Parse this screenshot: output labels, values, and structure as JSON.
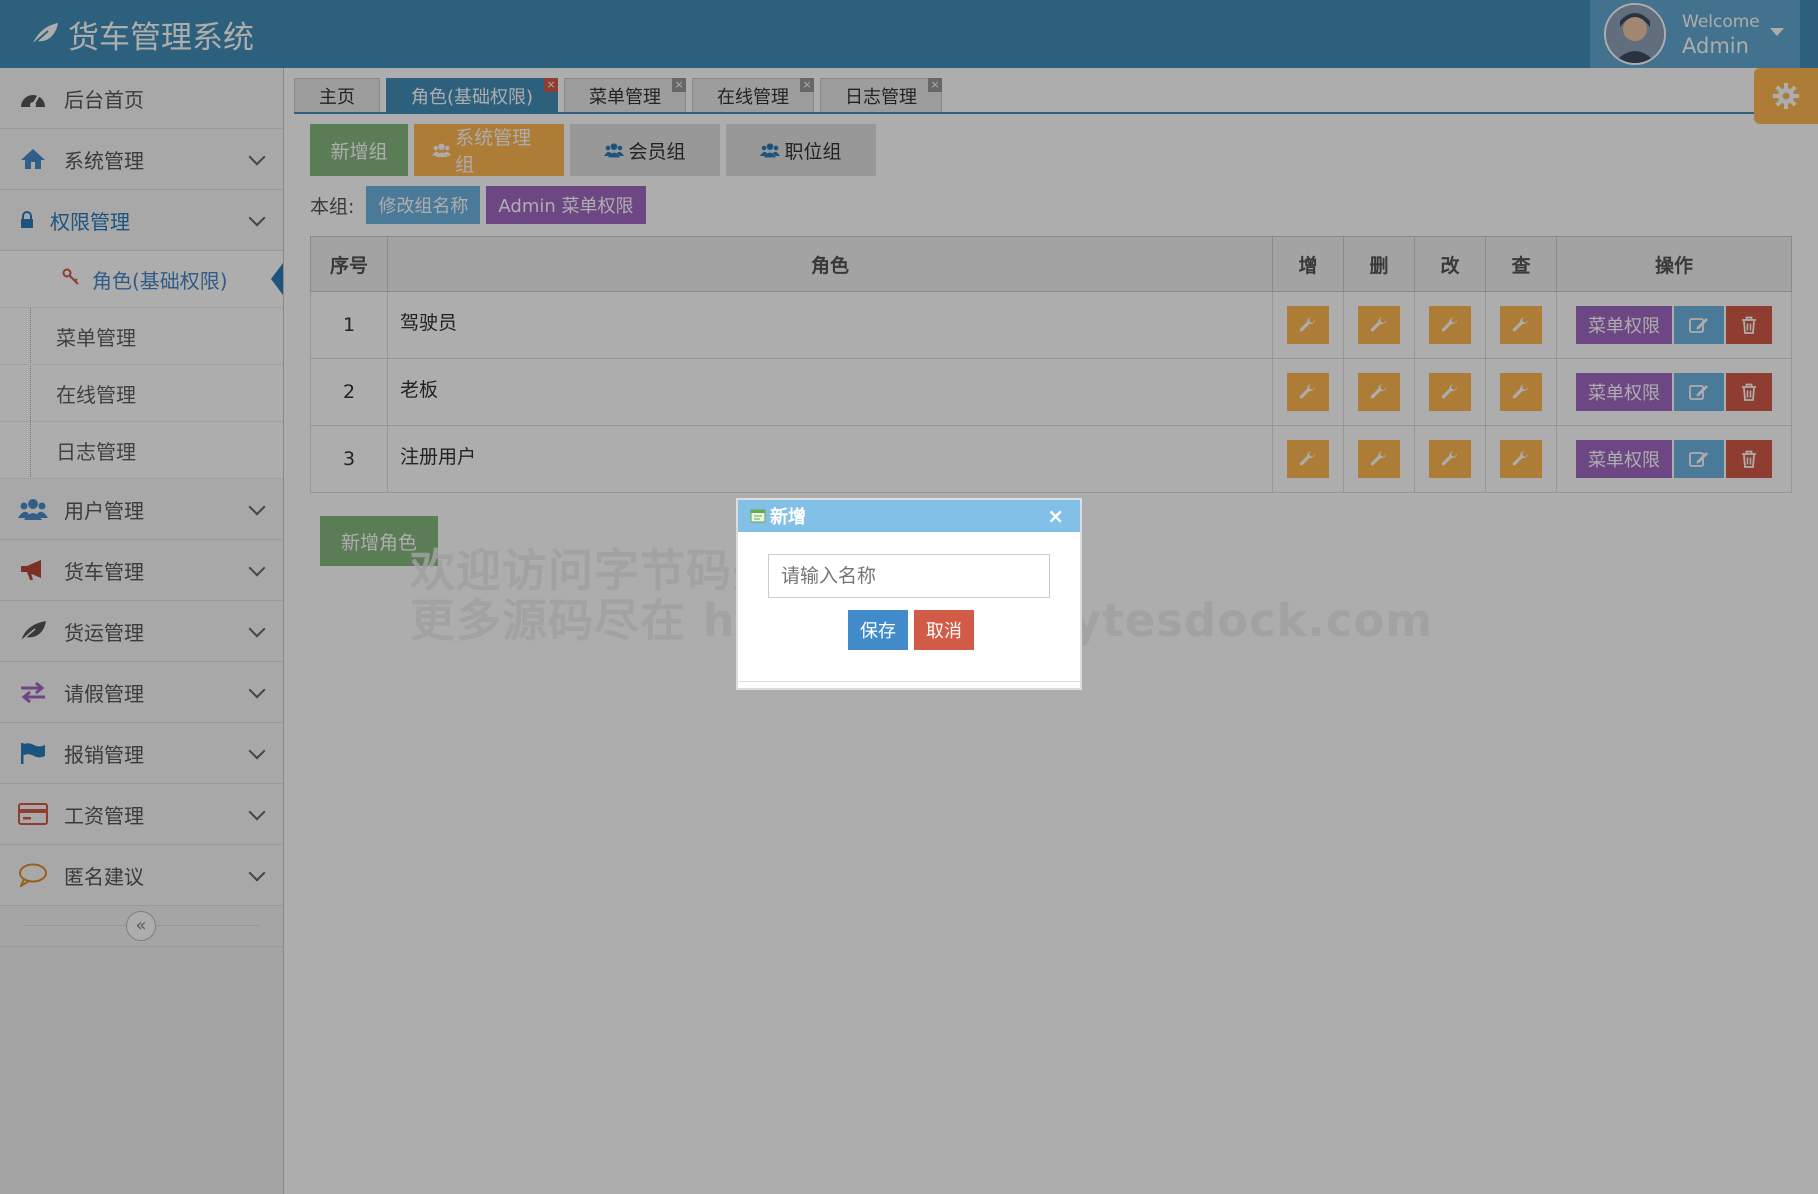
{
  "header": {
    "brand": "货车管理系统",
    "welcome": "Welcome",
    "user": "Admin"
  },
  "sidebar": {
    "items": [
      {
        "label": "后台首页",
        "icon": "dashboard-icon"
      },
      {
        "label": "系统管理",
        "icon": "home-icon"
      },
      {
        "label": "权限管理",
        "icon": "lock-icon"
      },
      {
        "label": "用户管理",
        "icon": "users-icon"
      },
      {
        "label": "货车管理",
        "icon": "bullhorn-icon"
      },
      {
        "label": "货运管理",
        "icon": "leaf-icon"
      },
      {
        "label": "请假管理",
        "icon": "exchange-icon"
      },
      {
        "label": "报销管理",
        "icon": "flag-icon"
      },
      {
        "label": "工资管理",
        "icon": "credit-card-icon"
      },
      {
        "label": "匿名建议",
        "icon": "comment-icon"
      }
    ],
    "sub_items": [
      "角色(基础权限)",
      "菜单管理",
      "在线管理",
      "日志管理"
    ],
    "collapse": "«"
  },
  "tabs": [
    "主页",
    "角色(基础权限)",
    "菜单管理",
    "在线管理",
    "日志管理"
  ],
  "tab_close": "×",
  "groups": [
    "新增组",
    "系统管理组",
    "会员组",
    "职位组"
  ],
  "group_label": "本组:",
  "group_actions": [
    "修改组名称",
    "Admin 菜单权限"
  ],
  "table": {
    "headers": [
      "序号",
      "角色",
      "增",
      "删",
      "改",
      "查",
      "操作"
    ],
    "rows": [
      {
        "num": "1",
        "role": "驾驶员"
      },
      {
        "num": "2",
        "role": "老板"
      },
      {
        "num": "3",
        "role": "注册用户"
      }
    ],
    "menu_btn": "菜单权限"
  },
  "add_role": "新增角色",
  "watermark": {
    "line1": "欢迎访问字节码头",
    "line2": "更多源码尽在 https://www.bytesdock.com"
  },
  "dialog": {
    "title": "新增",
    "close": "×",
    "placeholder": "请输入名称",
    "save": "保存",
    "cancel": "取消"
  },
  "colors": {
    "primary": "#438eb9",
    "green": "#87b87f",
    "yellow": "#ffb752",
    "purple": "#a069c3",
    "red": "#d15b47",
    "blue": "#6fb3e0"
  }
}
